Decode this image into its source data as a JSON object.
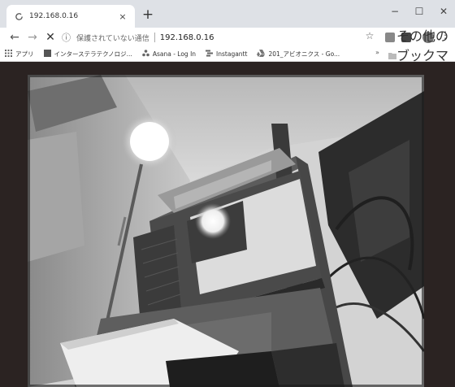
{
  "tab": {
    "title": "192.168.0.16",
    "favicon": "reload-icon",
    "close_symbol": "×"
  },
  "window": {
    "new_tab_symbol": "+",
    "minimize_symbol": "−",
    "maximize_symbol": "☐",
    "close_symbol": "✕"
  },
  "toolbar": {
    "back_symbol": "←",
    "forward_symbol": "→",
    "stop_symbol": "✕",
    "security_label": "保護されていない通信",
    "url": "192.168.0.16",
    "bookmark_star": "☆",
    "menu_symbol": "⋮"
  },
  "bookmarks": {
    "items": [
      {
        "icon": "apps-icon",
        "label": "アプリ"
      },
      {
        "icon": "bookmark-icon",
        "label": "インターステラテクノロジ..."
      },
      {
        "icon": "asana-icon",
        "label": "Asana - Log In"
      },
      {
        "icon": "instagantt-icon",
        "label": "Instagantt"
      },
      {
        "icon": "drive-icon",
        "label": "201_アビオニクス - Go..."
      }
    ],
    "overflow": "»",
    "other_label": "その他のブックマーク"
  },
  "colors": {
    "tabstrip": "#dee1e6",
    "viewport_bg": "#2b2322"
  }
}
